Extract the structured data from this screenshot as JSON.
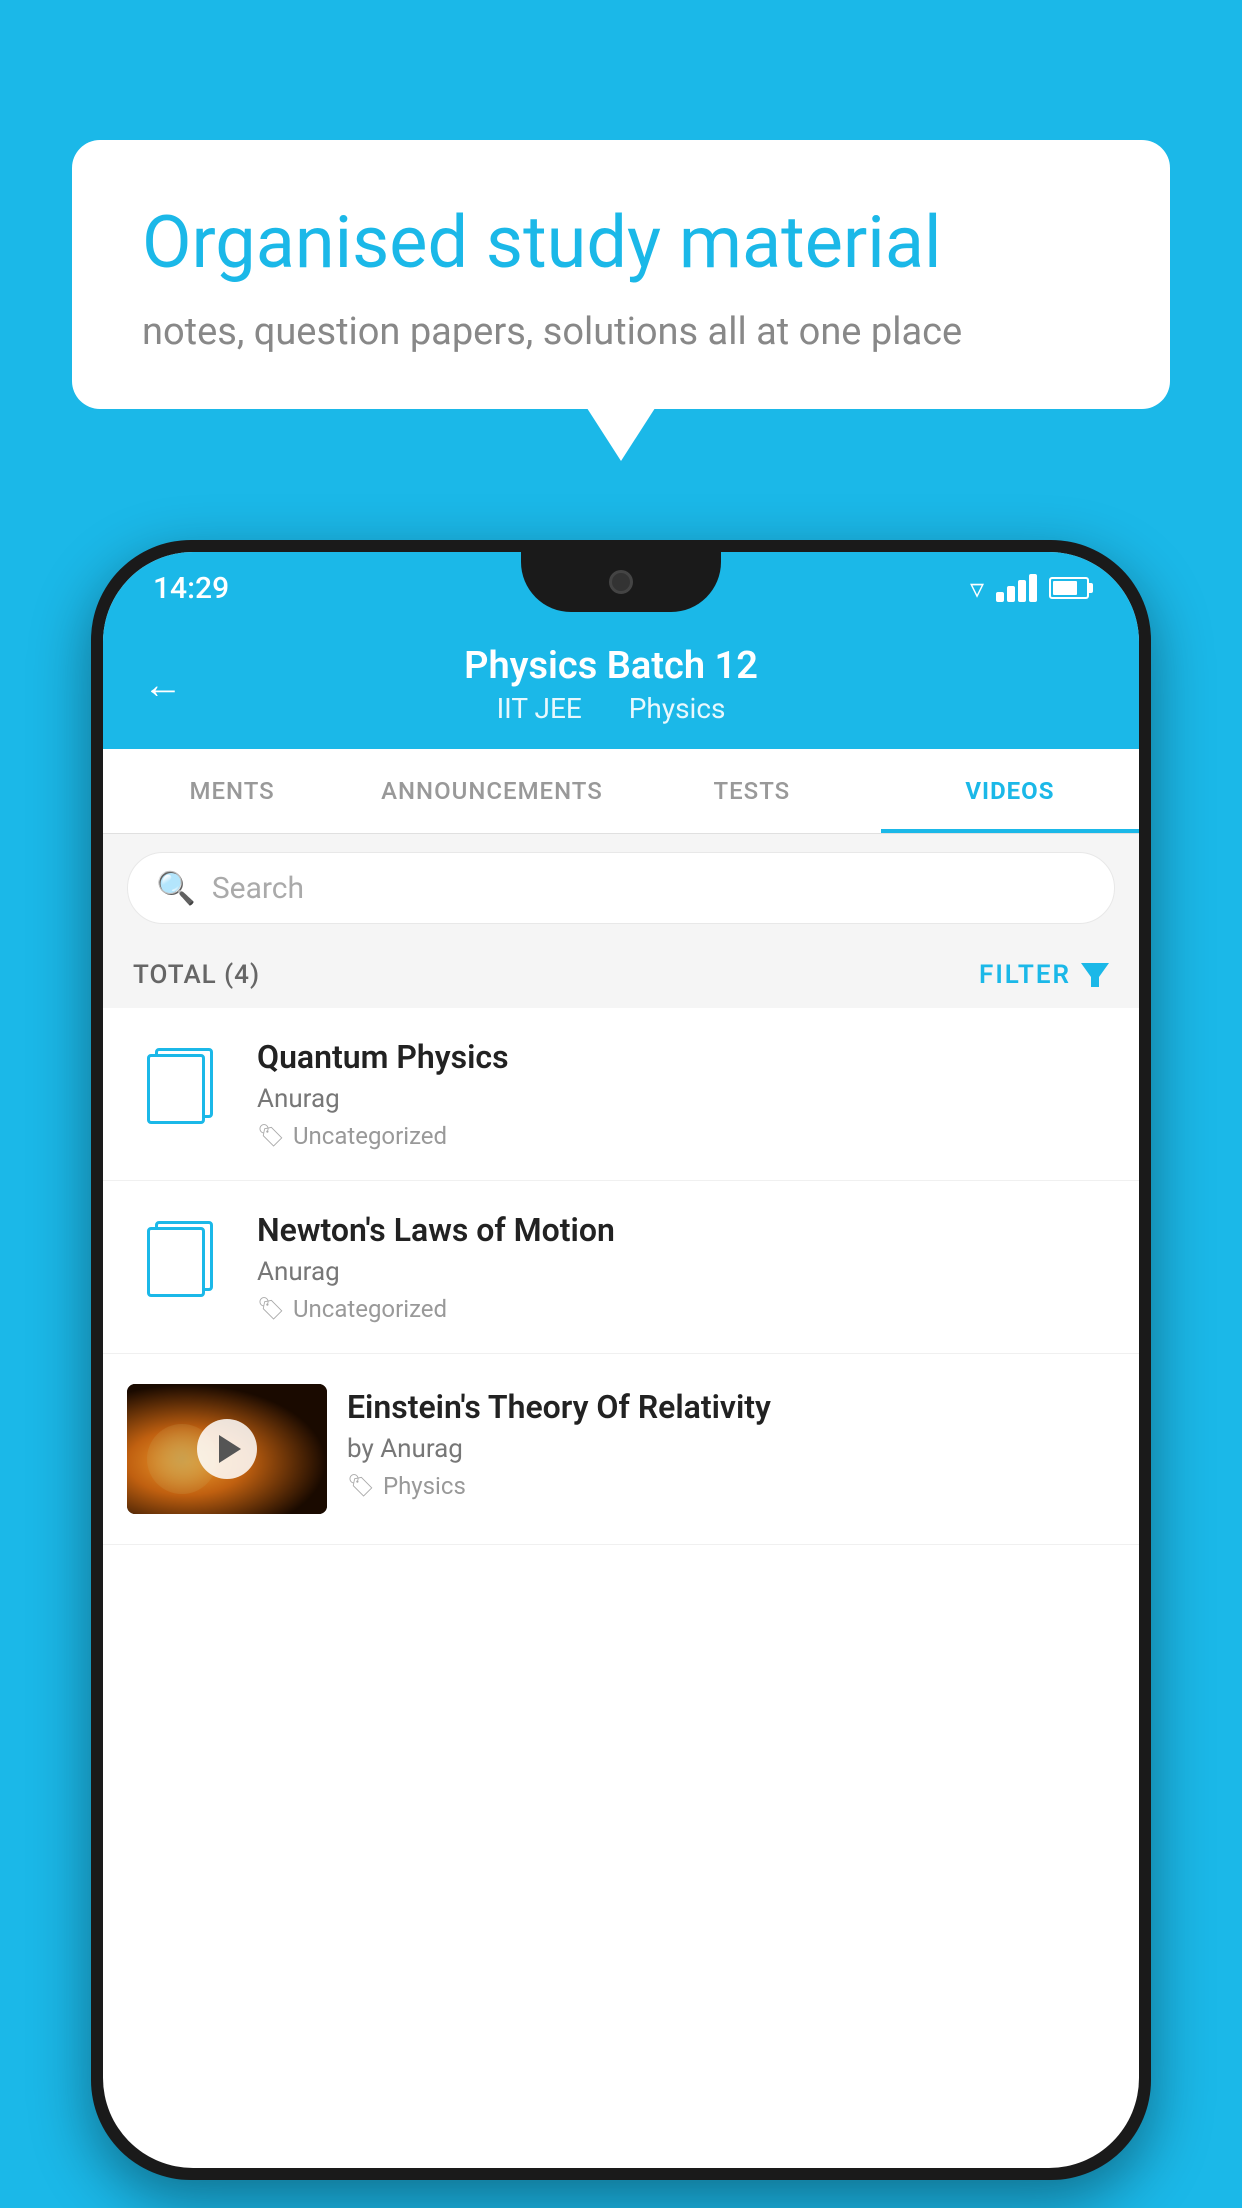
{
  "background_color": "#1BB8E8",
  "speech_bubble": {
    "heading": "Organised study material",
    "subtext": "notes, question papers, solutions all at one place"
  },
  "status_bar": {
    "time": "14:29",
    "icons": [
      "wifi",
      "signal",
      "battery"
    ]
  },
  "app_header": {
    "back_label": "←",
    "title": "Physics Batch 12",
    "subtitle_part1": "IIT JEE",
    "subtitle_part2": "Physics"
  },
  "tabs": [
    {
      "label": "MENTS",
      "active": false
    },
    {
      "label": "ANNOUNCEMENTS",
      "active": false
    },
    {
      "label": "TESTS",
      "active": false
    },
    {
      "label": "VIDEOS",
      "active": true
    }
  ],
  "search": {
    "placeholder": "Search"
  },
  "filter_bar": {
    "total_label": "TOTAL (4)",
    "filter_label": "FILTER"
  },
  "videos": [
    {
      "id": 1,
      "title": "Quantum Physics",
      "author": "Anurag",
      "tag": "Uncategorized",
      "has_thumb": false
    },
    {
      "id": 2,
      "title": "Newton's Laws of Motion",
      "author": "Anurag",
      "tag": "Uncategorized",
      "has_thumb": false
    },
    {
      "id": 3,
      "title": "Einstein's Theory Of Relativity",
      "author": "by Anurag",
      "tag": "Physics",
      "has_thumb": true
    }
  ]
}
